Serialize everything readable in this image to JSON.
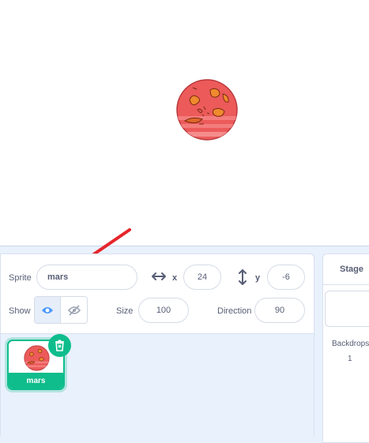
{
  "sprite_info": {
    "sprite_label": "Sprite",
    "sprite_name": "mars",
    "x_label": "x",
    "x_value": "24",
    "y_label": "y",
    "y_value": "-6",
    "show_label": "Show",
    "size_label": "Size",
    "size_value": "100",
    "direction_label": "Direction",
    "direction_value": "90"
  },
  "sprite_list": {
    "items": [
      {
        "name": "mars",
        "selected": true
      }
    ]
  },
  "stage_panel": {
    "title": "Stage",
    "backdrops_label": "Backdrops",
    "backdrops_count": "1"
  },
  "colors": {
    "accent": "#0fbd8c",
    "annotation_arrow": "#e5262b",
    "mars_base": "#ec5a5a",
    "mars_spots": "#f08a2e"
  },
  "icons": {
    "x_arrow": "horizontal-arrows-icon",
    "y_arrow": "vertical-arrows-icon",
    "show_visible": "eye-icon",
    "show_hidden": "eye-slash-icon",
    "delete": "trash-icon"
  }
}
